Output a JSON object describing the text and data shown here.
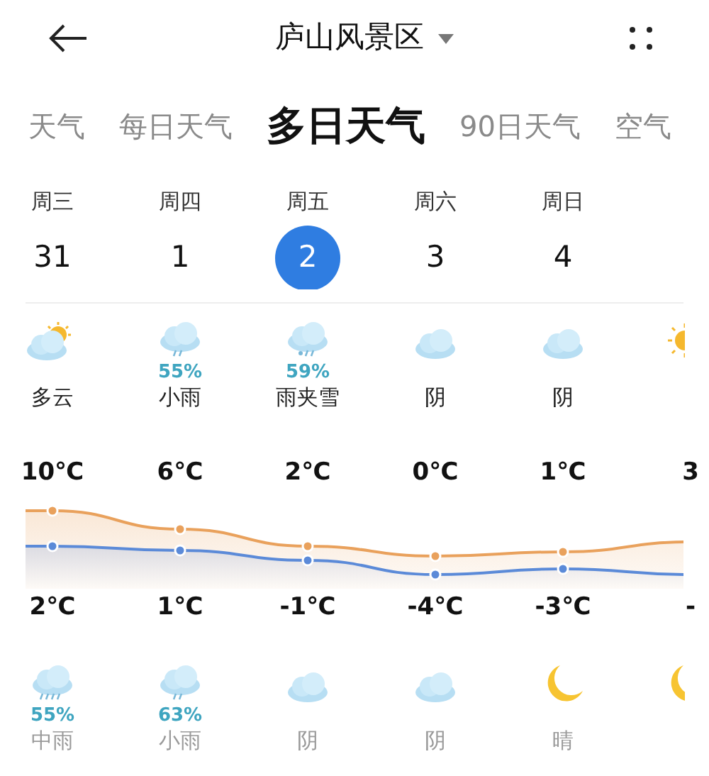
{
  "header": {
    "title": "庐山风景区"
  },
  "tabs": [
    {
      "label": "天气",
      "selected": false
    },
    {
      "label": "每日天气",
      "selected": false
    },
    {
      "label": "多日天气",
      "selected": true
    },
    {
      "label": "90日天气",
      "selected": false
    },
    {
      "label": "空气",
      "selected": false
    }
  ],
  "days": [
    {
      "weekday": "周三",
      "date": "31",
      "selected": false,
      "day": {
        "kind": "partly_cloudy",
        "condition": "多云"
      },
      "high": "10℃",
      "low": "2℃",
      "night": {
        "kind": "moderate_rain",
        "chance": "55%",
        "condition": "中雨"
      }
    },
    {
      "weekday": "周四",
      "date": "1",
      "selected": false,
      "day": {
        "kind": "light_rain",
        "chance": "55%",
        "condition": "小雨"
      },
      "high": "6℃",
      "low": "1℃",
      "night": {
        "kind": "light_rain",
        "chance": "63%",
        "condition": "小雨"
      }
    },
    {
      "weekday": "周五",
      "date": "2",
      "selected": true,
      "day": {
        "kind": "sleet",
        "chance": "59%",
        "condition": "雨夹雪"
      },
      "high": "2℃",
      "low": "-1℃",
      "night": {
        "kind": "overcast",
        "condition": "阴"
      }
    },
    {
      "weekday": "周六",
      "date": "3",
      "selected": false,
      "day": {
        "kind": "overcast",
        "condition": "阴"
      },
      "high": "0℃",
      "low": "-4℃",
      "night": {
        "kind": "overcast",
        "condition": "阴"
      }
    },
    {
      "weekday": "周日",
      "date": "4",
      "selected": false,
      "day": {
        "kind": "overcast",
        "condition": "阴"
      },
      "high": "1℃",
      "low": "-3℃",
      "night": {
        "kind": "moon",
        "condition": "晴"
      }
    },
    {
      "day": {
        "kind": "sunny"
      },
      "high": "3",
      "low": "-",
      "night": {
        "kind": "moon"
      }
    }
  ]
}
